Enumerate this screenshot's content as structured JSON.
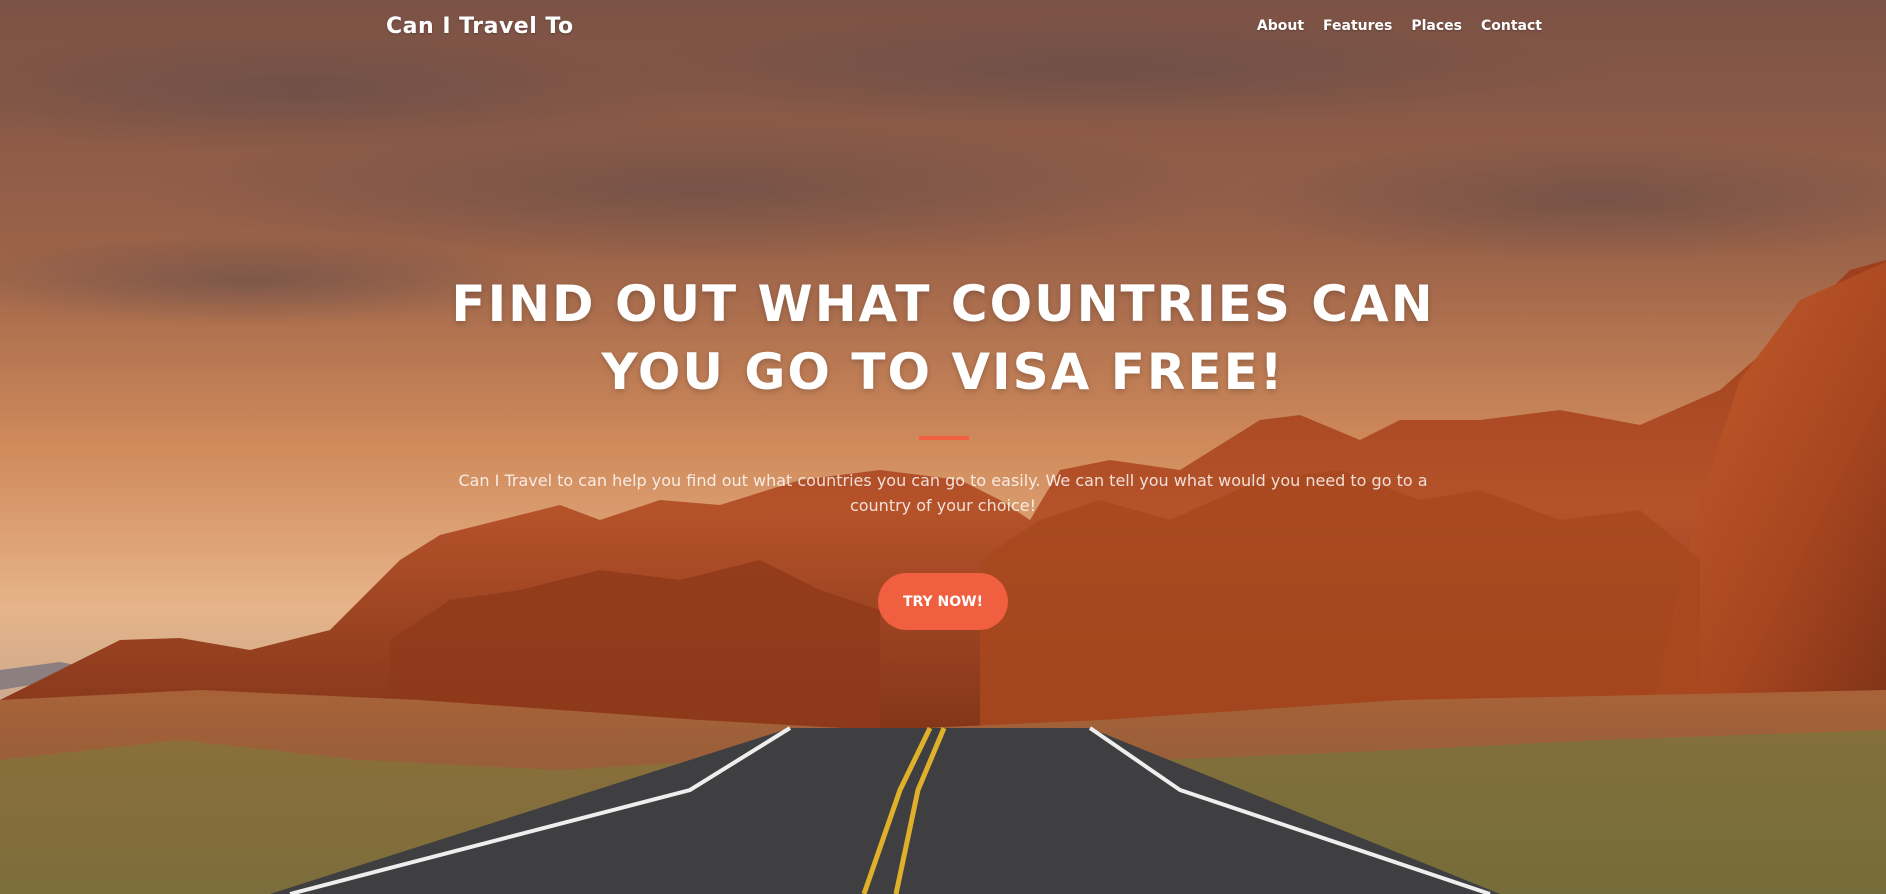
{
  "brand": "Can I Travel To",
  "nav": {
    "items": [
      "About",
      "Features",
      "Places",
      "Contact"
    ]
  },
  "hero": {
    "headline_line1": "FIND OUT WHAT COUNTRIES CAN",
    "headline_line2": "YOU GO TO VISA FREE!",
    "description": "Can I Travel to can help you find out what countries you can go to easily. We can tell you what would you need to go to a country of your choice!",
    "cta_label": "TRY NOW!"
  },
  "colors": {
    "accent": "#f05f40",
    "sky_top": "#8a5a44",
    "sky_bottom": "#e7b68a",
    "rock": "#b24e24",
    "road": "#3f3f42"
  }
}
